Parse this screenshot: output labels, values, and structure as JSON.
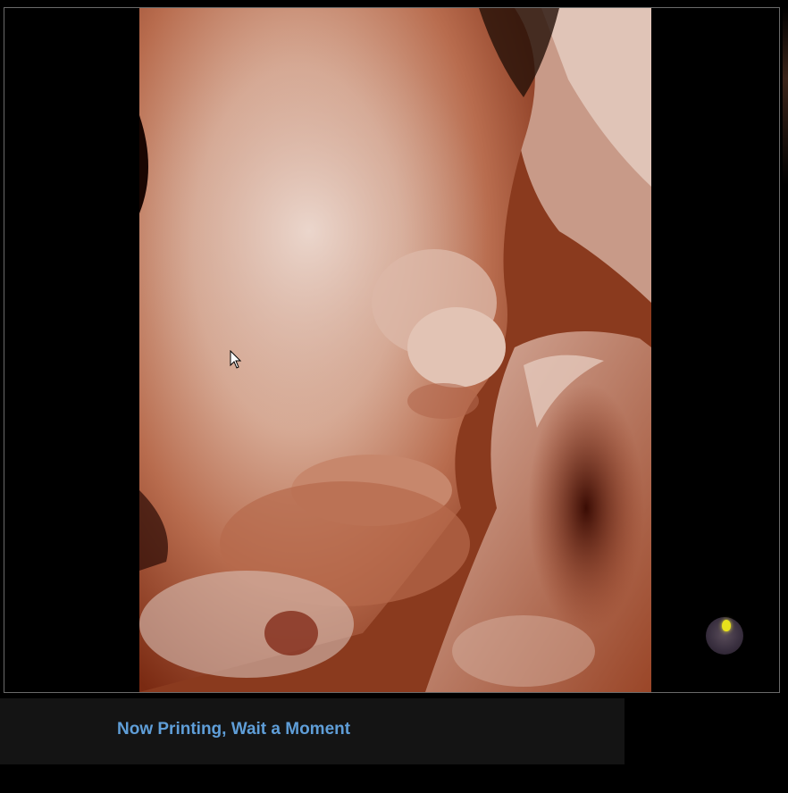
{
  "status": {
    "message": "Now Printing, Wait a Moment"
  },
  "viewer": {
    "image_description_icon": "fetal-face-3d-render",
    "colors": {
      "background": "#000000",
      "status_bar": "#141414",
      "status_text": "#5f9ed8",
      "light_indicator": "#e8e21c"
    }
  }
}
